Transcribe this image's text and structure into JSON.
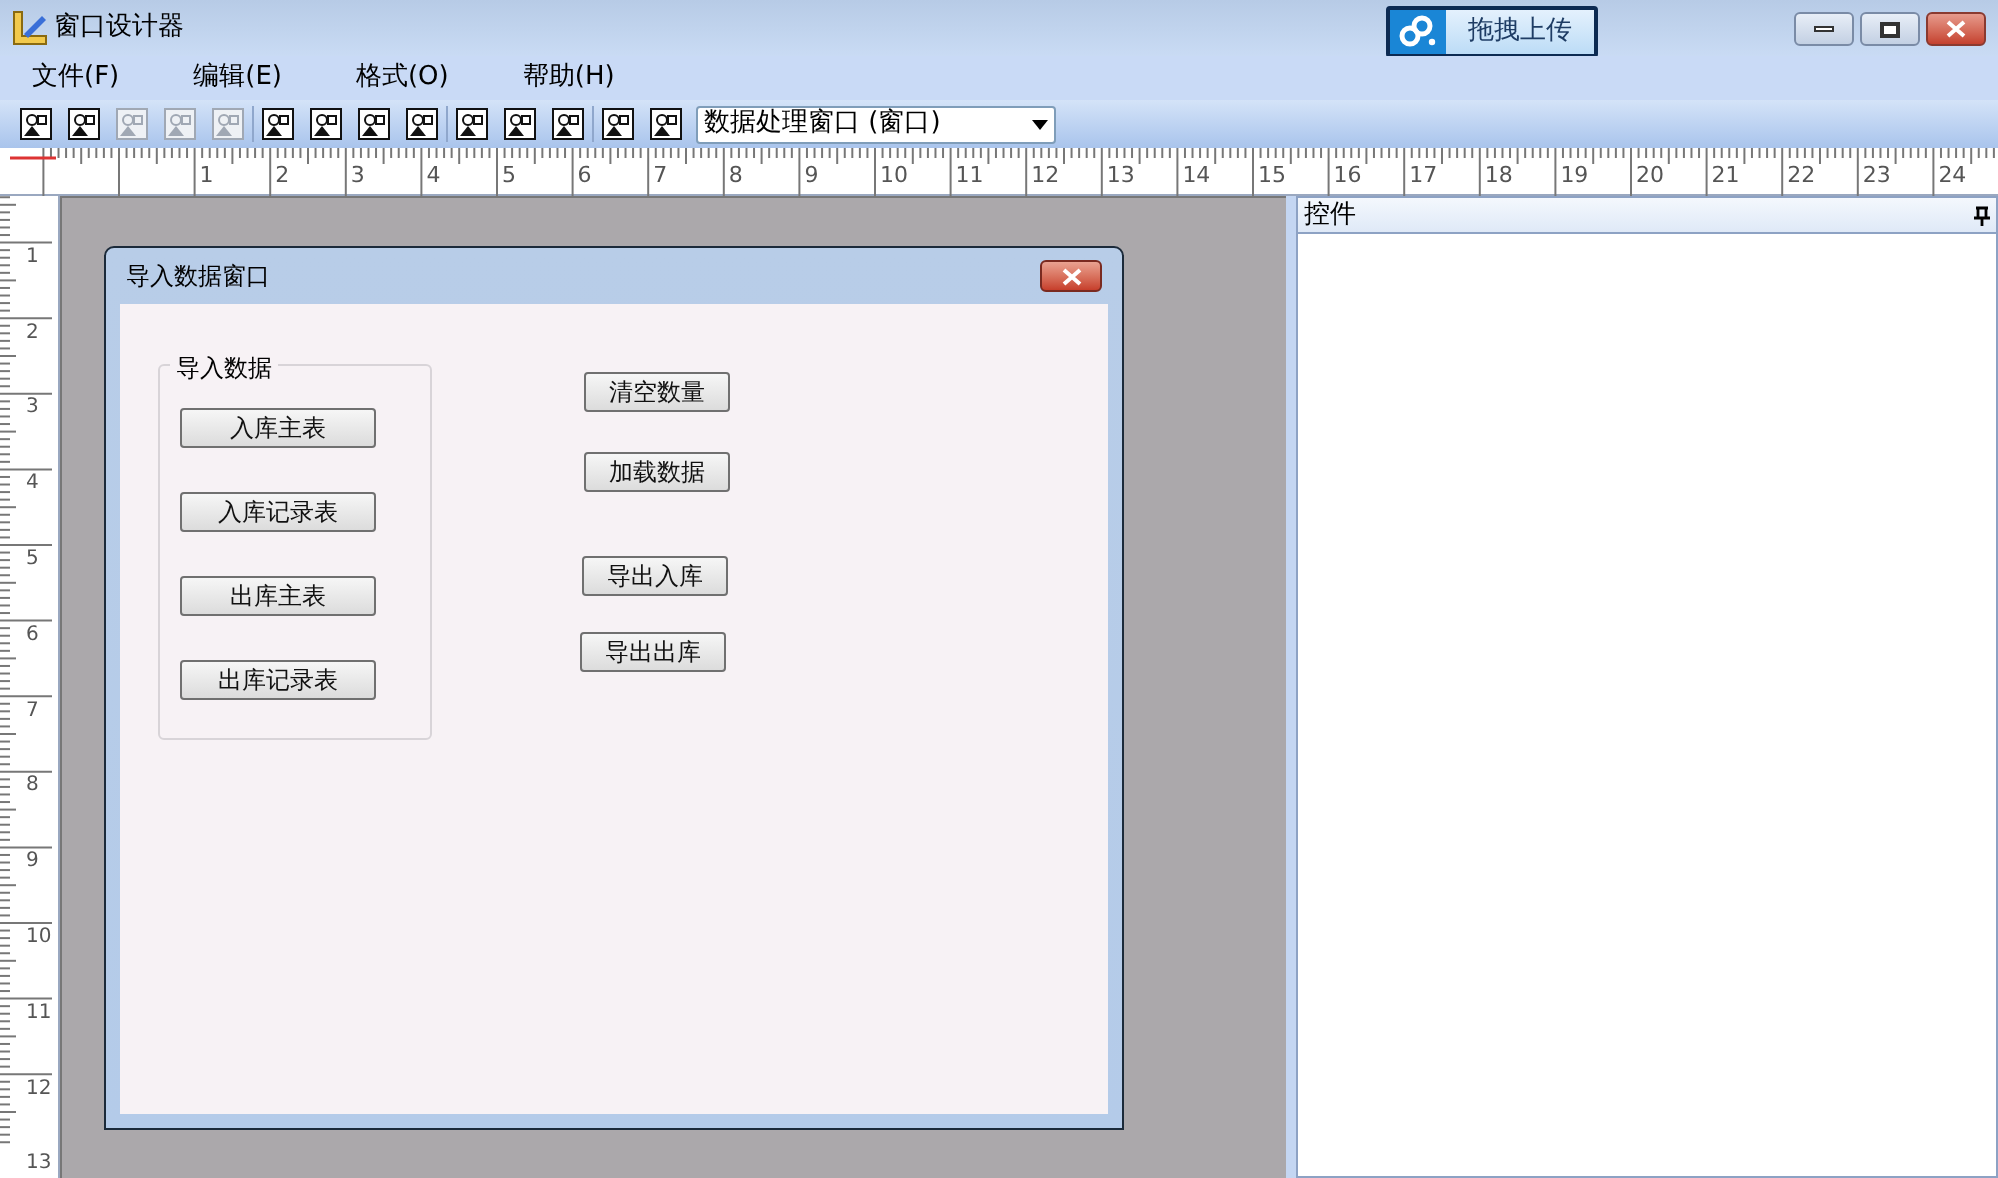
{
  "window": {
    "title": "窗口设计器"
  },
  "upload_button": {
    "label": "拖拽上传"
  },
  "menu": [
    {
      "label": "文件(F)"
    },
    {
      "label": "编辑(E)"
    },
    {
      "label": "格式(O)"
    },
    {
      "label": "帮助(H)"
    }
  ],
  "toolbar": {
    "groups": [
      [
        {
          "disabled": false
        },
        {
          "disabled": false
        },
        {
          "disabled": true
        },
        {
          "disabled": true
        },
        {
          "disabled": true
        }
      ],
      [
        {
          "disabled": false
        },
        {
          "disabled": false
        },
        {
          "disabled": false
        },
        {
          "disabled": false
        }
      ],
      [
        {
          "disabled": false
        },
        {
          "disabled": false
        },
        {
          "disabled": false
        }
      ],
      [
        {
          "disabled": false
        },
        {
          "disabled": false
        }
      ]
    ],
    "window_select": {
      "value": "数据处理窗口 (窗口)"
    }
  },
  "horizontal_ruler": [
    "1",
    "2",
    "3",
    "4",
    "5",
    "6",
    "7",
    "8",
    "9",
    "10",
    "11",
    "12",
    "13",
    "14",
    "15",
    "16",
    "17",
    "18",
    "19",
    "20",
    "21",
    "22",
    "23",
    "24"
  ],
  "vertical_ruler": [
    "1",
    "2",
    "3",
    "4",
    "5",
    "6",
    "7",
    "8",
    "9",
    "10",
    "11",
    "12",
    "13"
  ],
  "form": {
    "title": "导入数据窗口",
    "group": {
      "label": "导入数据",
      "buttons": [
        "入库主表",
        "入库记录表",
        "出库主表",
        "出库记录表"
      ]
    },
    "buttons": [
      "清空数量",
      "加载数据",
      "导出入库",
      "导出出库"
    ]
  },
  "controls_panel": {
    "title": "控件"
  }
}
